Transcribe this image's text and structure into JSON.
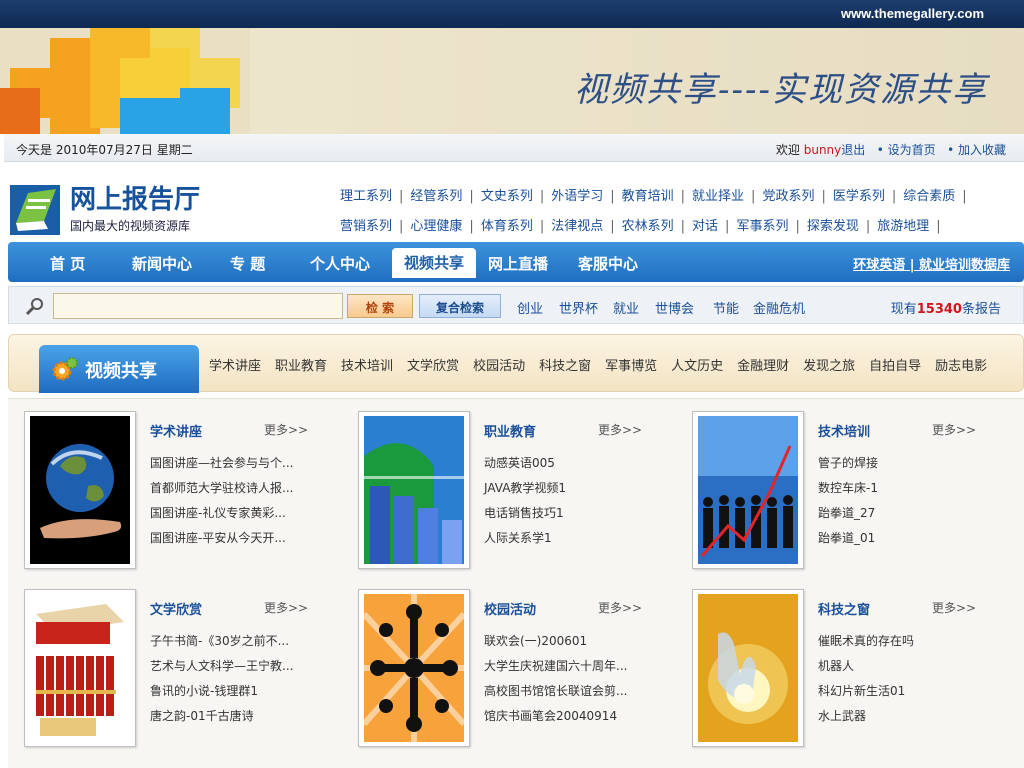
{
  "slide": {
    "url": "www.themegallery.com",
    "title": "视频共享----实现资源共享"
  },
  "site": {
    "datebar": {
      "date": "今天是 2010年07月27日 星期二",
      "welcome": "欢迎",
      "user": "bunny",
      "logout": "退出",
      "set_home": "• 设为首页",
      "bookmark": "• 加入收藏"
    },
    "logo": {
      "name": "网上报告厅",
      "slogan": "国内最大的视频资源库"
    },
    "categories_row1": [
      "理工系列",
      "经管系列",
      "文史系列",
      "外语学习",
      "教育培训",
      "就业择业",
      "党政系列",
      "医学系列",
      "综合素质"
    ],
    "categories_row2": [
      "营销系列",
      "心理健康",
      "体育系列",
      "法律视点",
      "农林系列",
      "对话",
      "军事系列",
      "探索发现",
      "旅游地理"
    ],
    "nav": {
      "items": [
        "首  页",
        "新闻中心",
        "专  题",
        "个人中心",
        "视频共享",
        "网上直播",
        "客服中心"
      ],
      "active": "视频共享",
      "right_links": "环球英语 | 就业培训数据库"
    },
    "search": {
      "placeholder": "",
      "search_btn": "检  索",
      "adv_btn": "复合检索",
      "hot": [
        "创业",
        "世界杯",
        "就业",
        "世博会",
        "节能",
        "金融危机"
      ],
      "count_prefix": "现有",
      "count": "15340",
      "count_suffix": "条报告"
    },
    "channel": {
      "title": "视频共享",
      "subtabs": [
        "学术讲座",
        "职业教育",
        "技术培训",
        "文学欣赏",
        "校园活动",
        "科技之窗",
        "军事博览",
        "人文历史",
        "金融理财",
        "发现之旅",
        "自拍自导",
        "励志电影"
      ]
    },
    "cards": [
      {
        "title": "学术讲座",
        "more": "更多>>",
        "items": [
          "国图讲座—社会参与与个...",
          "首都师范大学驻校诗人报...",
          "国图讲座-礼仪专家黄彩...",
          "国图讲座-平安从今天开..."
        ],
        "thumb": "earth-in-hand-thumbnail"
      },
      {
        "title": "职业教育",
        "more": "更多>>",
        "items": [
          "动感英语005",
          "JAVA教学视频1",
          "电话销售技巧1",
          "人际关系学1"
        ],
        "thumb": "bar-chart-thumbnail"
      },
      {
        "title": "技术培训",
        "more": "更多>>",
        "items": [
          "管子的焊接",
          "数控车床-1",
          "跆拳道_27",
          "跆拳道_01"
        ],
        "thumb": "crowd-growth-thumbnail"
      },
      {
        "title": "文学欣赏",
        "more": "更多>>",
        "items": [
          "子午书简-《30岁之前不...",
          "艺术与人文科学—王宁教...",
          "鲁讯的小说-钱理群1",
          "唐之韵-01千古唐诗"
        ],
        "thumb": "book-set-thumbnail"
      },
      {
        "title": "校园活动",
        "more": "更多>>",
        "items": [
          "联欢会(一)200601",
          "大学生庆祝建国六十周年...",
          "高校图书馆馆长联谊会剪...",
          "馆庆书画笔会20040914"
        ],
        "thumb": "people-circle-thumbnail"
      },
      {
        "title": "科技之窗",
        "more": "更多>>",
        "items": [
          "催眠术真的存在吗",
          "机器人",
          "科幻片新生活01",
          "水上武器"
        ],
        "thumb": "hand-light-thumbnail"
      }
    ]
  }
}
